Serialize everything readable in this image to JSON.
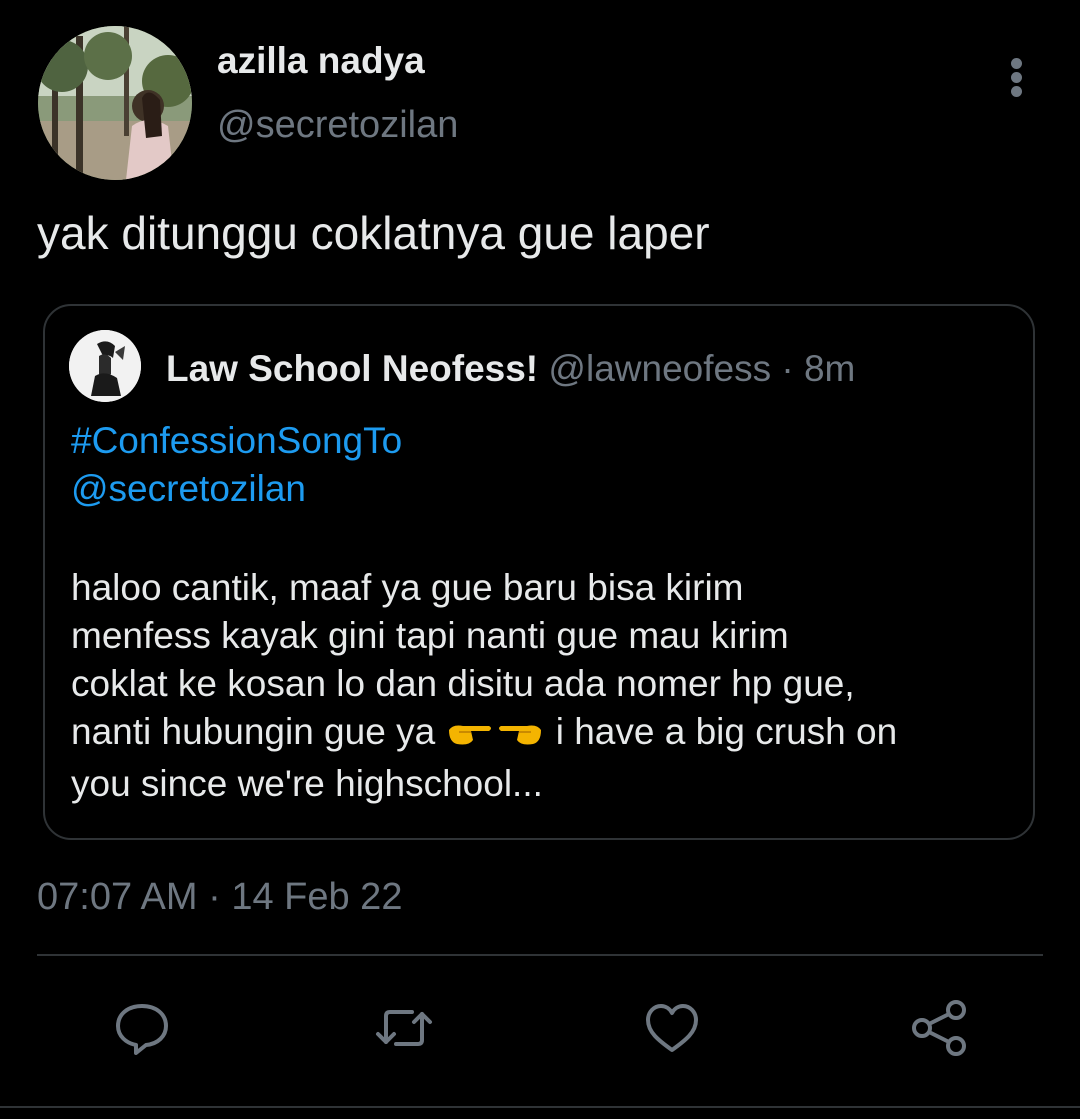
{
  "tweet": {
    "author": {
      "display_name": "azilla nadya",
      "handle": "@secretozilan"
    },
    "text": "yak ditunggu coklatnya gue laper",
    "timestamp": "07:07 AM · 14 Feb 22",
    "more_icon": "more-vertical-icon"
  },
  "quote": {
    "name": "Law School Neofess!",
    "handle": "@lawneofess",
    "separator": "·",
    "time": "8m",
    "hashtag": "#ConfessionSongTo",
    "mention": "@secretozilan",
    "lines": [
      "haloo cantik, maaf ya gue baru bisa kirim",
      "menfess kayak gini tapi nanti gue mau kirim",
      "coklat ke kosan lo dan disitu ada nomer hp gue,",
      "nanti hubungin gue ya",
      "i have a big crush on",
      "you since we're highschool..."
    ],
    "emoji_icons": [
      "pointing-right-emoji",
      "pointing-left-emoji"
    ]
  },
  "actions": [
    {
      "name": "reply",
      "icon": "reply-bubble-icon"
    },
    {
      "name": "retweet",
      "icon": "retweet-icon"
    },
    {
      "name": "like",
      "icon": "heart-icon"
    },
    {
      "name": "share",
      "icon": "share-icon"
    }
  ],
  "colors": {
    "background": "#000000",
    "primary_text": "#e7e9ea",
    "secondary_text": "#6e7781",
    "link": "#1d9bf0",
    "border": "#2f3336"
  }
}
